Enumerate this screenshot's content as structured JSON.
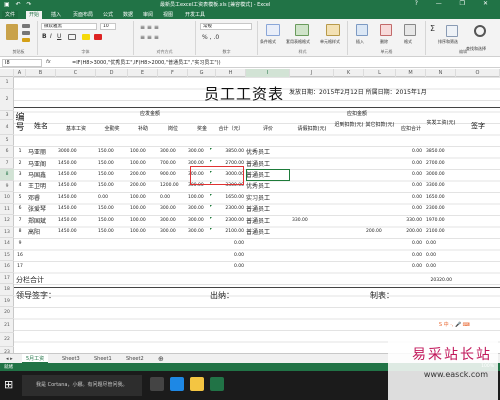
{
  "window": {
    "title": "最新员工excel工资表模板.xls [兼容模式] - Excel",
    "qat_icons": [
      "save-icon",
      "undo-icon",
      "redo-icon"
    ],
    "controls": [
      "?",
      "—",
      "❐",
      "✕"
    ]
  },
  "ribbon": {
    "tabs": [
      "文件",
      "开始",
      "插入",
      "页面布局",
      "公式",
      "数据",
      "审阅",
      "视图",
      "开发工具"
    ],
    "active_tab": "开始",
    "groups": [
      "剪贴板",
      "字体",
      "对齐方式",
      "数字",
      "样式",
      "单元格",
      "编辑"
    ],
    "font_name": "微软雅黑",
    "font_size": "10",
    "number_format": "常规",
    "style_buttons": [
      "条件格式",
      "套用表格格式",
      "单元格样式"
    ],
    "cell_buttons": [
      "插入",
      "删除",
      "格式"
    ],
    "edit_buttons": [
      "排序和筛选",
      "查找和选择"
    ]
  },
  "formula_bar": {
    "name_box": "I8",
    "fx": "fx",
    "formula": "=IF(H8>3000,\"优秀员工\",IF(H8>2000,\"普通员工\",\"实习员工\"))"
  },
  "columns": [
    "A",
    "B",
    "C",
    "D",
    "E",
    "F",
    "G",
    "H",
    "I",
    "J",
    "K",
    "L",
    "M",
    "N",
    "O"
  ],
  "selected_column": "I",
  "rows": [
    "1",
    "2",
    "3",
    "4",
    "5",
    "6",
    "7",
    "8",
    "9",
    "10",
    "11",
    "12",
    "13",
    "14",
    "15",
    "16",
    "17",
    "18",
    "19",
    "20",
    "21",
    "22",
    "23",
    "24",
    "25",
    "26"
  ],
  "selected_row": "8",
  "sheet": {
    "title": "员工工资表",
    "issue_text": "发放日期：2015年2月12日 所属日期：2015年1月",
    "headers": {
      "no": "编号",
      "name": "姓名",
      "payable_group": "应发金额",
      "base": "基本工资",
      "full_attendance": "全勤奖",
      "allowance": "补助",
      "position": "岗位",
      "bonus": "奖金",
      "total": "合计（元）",
      "rating": "评价",
      "deduct_group": "应扣金额",
      "leave": "请假扣款(元)",
      "late": "迟到扣款(元)",
      "other": "其它扣款(元)",
      "deduct_total": "应扣合计",
      "actual": "实发工资(元)",
      "sign": "签字"
    },
    "employees": [
      {
        "no": "1",
        "name": "马亚丽",
        "base": "3000.00",
        "full": "150.00",
        "allow": "100.00",
        "pos": "300.00",
        "bonus": "300.00",
        "total": "3850.00",
        "rating": "优秀员工",
        "leave": "",
        "late": "",
        "other": "",
        "ded": "0.00",
        "actual": "3850.00"
      },
      {
        "no": "2",
        "name": "马亚阁",
        "base": "1450.00",
        "full": "150.00",
        "allow": "100.00",
        "pos": "700.00",
        "bonus": "300.00",
        "total": "2700.00",
        "rating": "普通员工",
        "leave": "",
        "late": "",
        "other": "",
        "ded": "0.00",
        "actual": "2700.00"
      },
      {
        "no": "3",
        "name": "马国鑫",
        "base": "1450.00",
        "full": "150.00",
        "allow": "200.00",
        "pos": "900.00",
        "bonus": "300.00",
        "total": "3000.00",
        "rating": "普通员工",
        "leave": "",
        "late": "",
        "other": "",
        "ded": "0.00",
        "actual": "3000.00"
      },
      {
        "no": "4",
        "name": "王卫明",
        "base": "1450.00",
        "full": "150.00",
        "allow": "200.00",
        "pos": "1200.00",
        "bonus": "300.00",
        "total": "3300.00",
        "rating": "优秀员工",
        "leave": "",
        "late": "",
        "other": "",
        "ded": "0.00",
        "actual": "3300.00"
      },
      {
        "no": "5",
        "name": "邓睿",
        "base": "1450.00",
        "full": "0.00",
        "allow": "100.00",
        "pos": "0.00",
        "bonus": "100.00",
        "total": "1650.00",
        "rating": "实习员工",
        "leave": "",
        "late": "",
        "other": "",
        "ded": "0.00",
        "actual": "1650.00"
      },
      {
        "no": "6",
        "name": "张爱琴",
        "base": "1450.00",
        "full": "150.00",
        "allow": "100.00",
        "pos": "300.00",
        "bonus": "300.00",
        "total": "2300.00",
        "rating": "普通员工",
        "leave": "",
        "late": "",
        "other": "",
        "ded": "0.00",
        "actual": "2300.00"
      },
      {
        "no": "7",
        "name": "郑国斌",
        "base": "1450.00",
        "full": "150.00",
        "allow": "100.00",
        "pos": "300.00",
        "bonus": "300.00",
        "total": "2300.00",
        "rating": "普通员工",
        "leave": "330.00",
        "late": "",
        "other": "",
        "ded": "330.00",
        "actual": "1970.00"
      },
      {
        "no": "8",
        "name": "高阳",
        "base": "1450.00",
        "full": "150.00",
        "allow": "100.00",
        "pos": "300.00",
        "bonus": "300.00",
        "total": "2100.00",
        "rating": "普通员工",
        "leave": "",
        "late": "",
        "other": "200.00",
        "ded": "200.00",
        "actual": "2100.00"
      }
    ],
    "empty_rows": [
      {
        "no": "9",
        "total": "0.00",
        "ded": "0.00",
        "actual": "0.00"
      },
      {
        "no": "16",
        "total": "0.00",
        "ded": "0.00",
        "actual": "0.00"
      },
      {
        "no": "17",
        "total": "0.00",
        "ded": "0.00",
        "actual": "0.00"
      }
    ],
    "sum_label": "分栏合计",
    "sum_total": "",
    "sum_actual": "20320.00",
    "footer": {
      "leader": "领导签字：",
      "cashier": "出纳：",
      "maker": "制表："
    }
  },
  "sheet_tabs": [
    "5月工资",
    "Sheet3",
    "Sheet1",
    "Sheet2"
  ],
  "active_sheet": "5月工资",
  "statusbar": {
    "status": "就绪",
    "zoom": "100%"
  },
  "taskbar": {
    "search": "我是 Cortana，小娜。有问题尽管问我。"
  },
  "watermark": {
    "brand": "易采站长站",
    "url": "www.easck.com"
  },
  "colors": {
    "excel_green": "#217346",
    "highlight_red": "#e03131"
  }
}
